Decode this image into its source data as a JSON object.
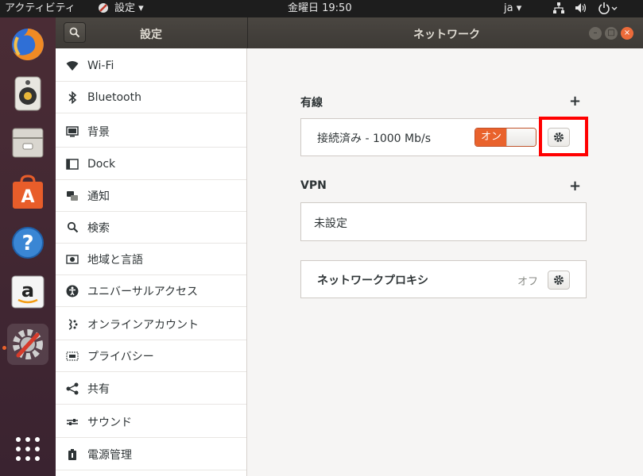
{
  "topbar": {
    "activities": "アクティビティ",
    "app_menu": "設定 ▾",
    "clock": "金曜日 19:50",
    "lang": "ja ▾"
  },
  "dock": {
    "apps": [
      "firefox-icon",
      "rhythmbox-icon",
      "files-icon",
      "software-center-icon",
      "help-icon",
      "amazon-icon",
      "settings-icon",
      "app-grid-icon"
    ]
  },
  "header": {
    "sidebar_title": "設定",
    "panel_title": "ネットワーク"
  },
  "sidebar": {
    "items": [
      {
        "label": "Wi-Fi",
        "icon": "wifi-icon"
      },
      {
        "label": "Bluetooth",
        "icon": "bluetooth-icon"
      },
      {
        "label": "背景",
        "icon": "background-icon"
      },
      {
        "label": "Dock",
        "icon": "dock-icon"
      },
      {
        "label": "通知",
        "icon": "notification-icon"
      },
      {
        "label": "検索",
        "icon": "search-icon"
      },
      {
        "label": "地域と言語",
        "icon": "region-icon"
      },
      {
        "label": "ユニバーサルアクセス",
        "icon": "accessibility-icon"
      },
      {
        "label": "オンラインアカウント",
        "icon": "online-accounts-icon"
      },
      {
        "label": "プライバシー",
        "icon": "privacy-icon"
      },
      {
        "label": "共有",
        "icon": "share-icon"
      },
      {
        "label": "サウンド",
        "icon": "sound-icon"
      },
      {
        "label": "電源管理",
        "icon": "power-icon"
      }
    ]
  },
  "network": {
    "wired": {
      "title": "有線",
      "status": "接続済み - 1000 Mb/s",
      "toggle_label": "オン"
    },
    "vpn": {
      "title": "VPN",
      "empty_label": "未設定"
    },
    "proxy": {
      "label": "ネットワークプロキシ",
      "state": "オフ"
    }
  },
  "colors": {
    "accent": "#e9622c",
    "highlight": "#ff0000"
  }
}
